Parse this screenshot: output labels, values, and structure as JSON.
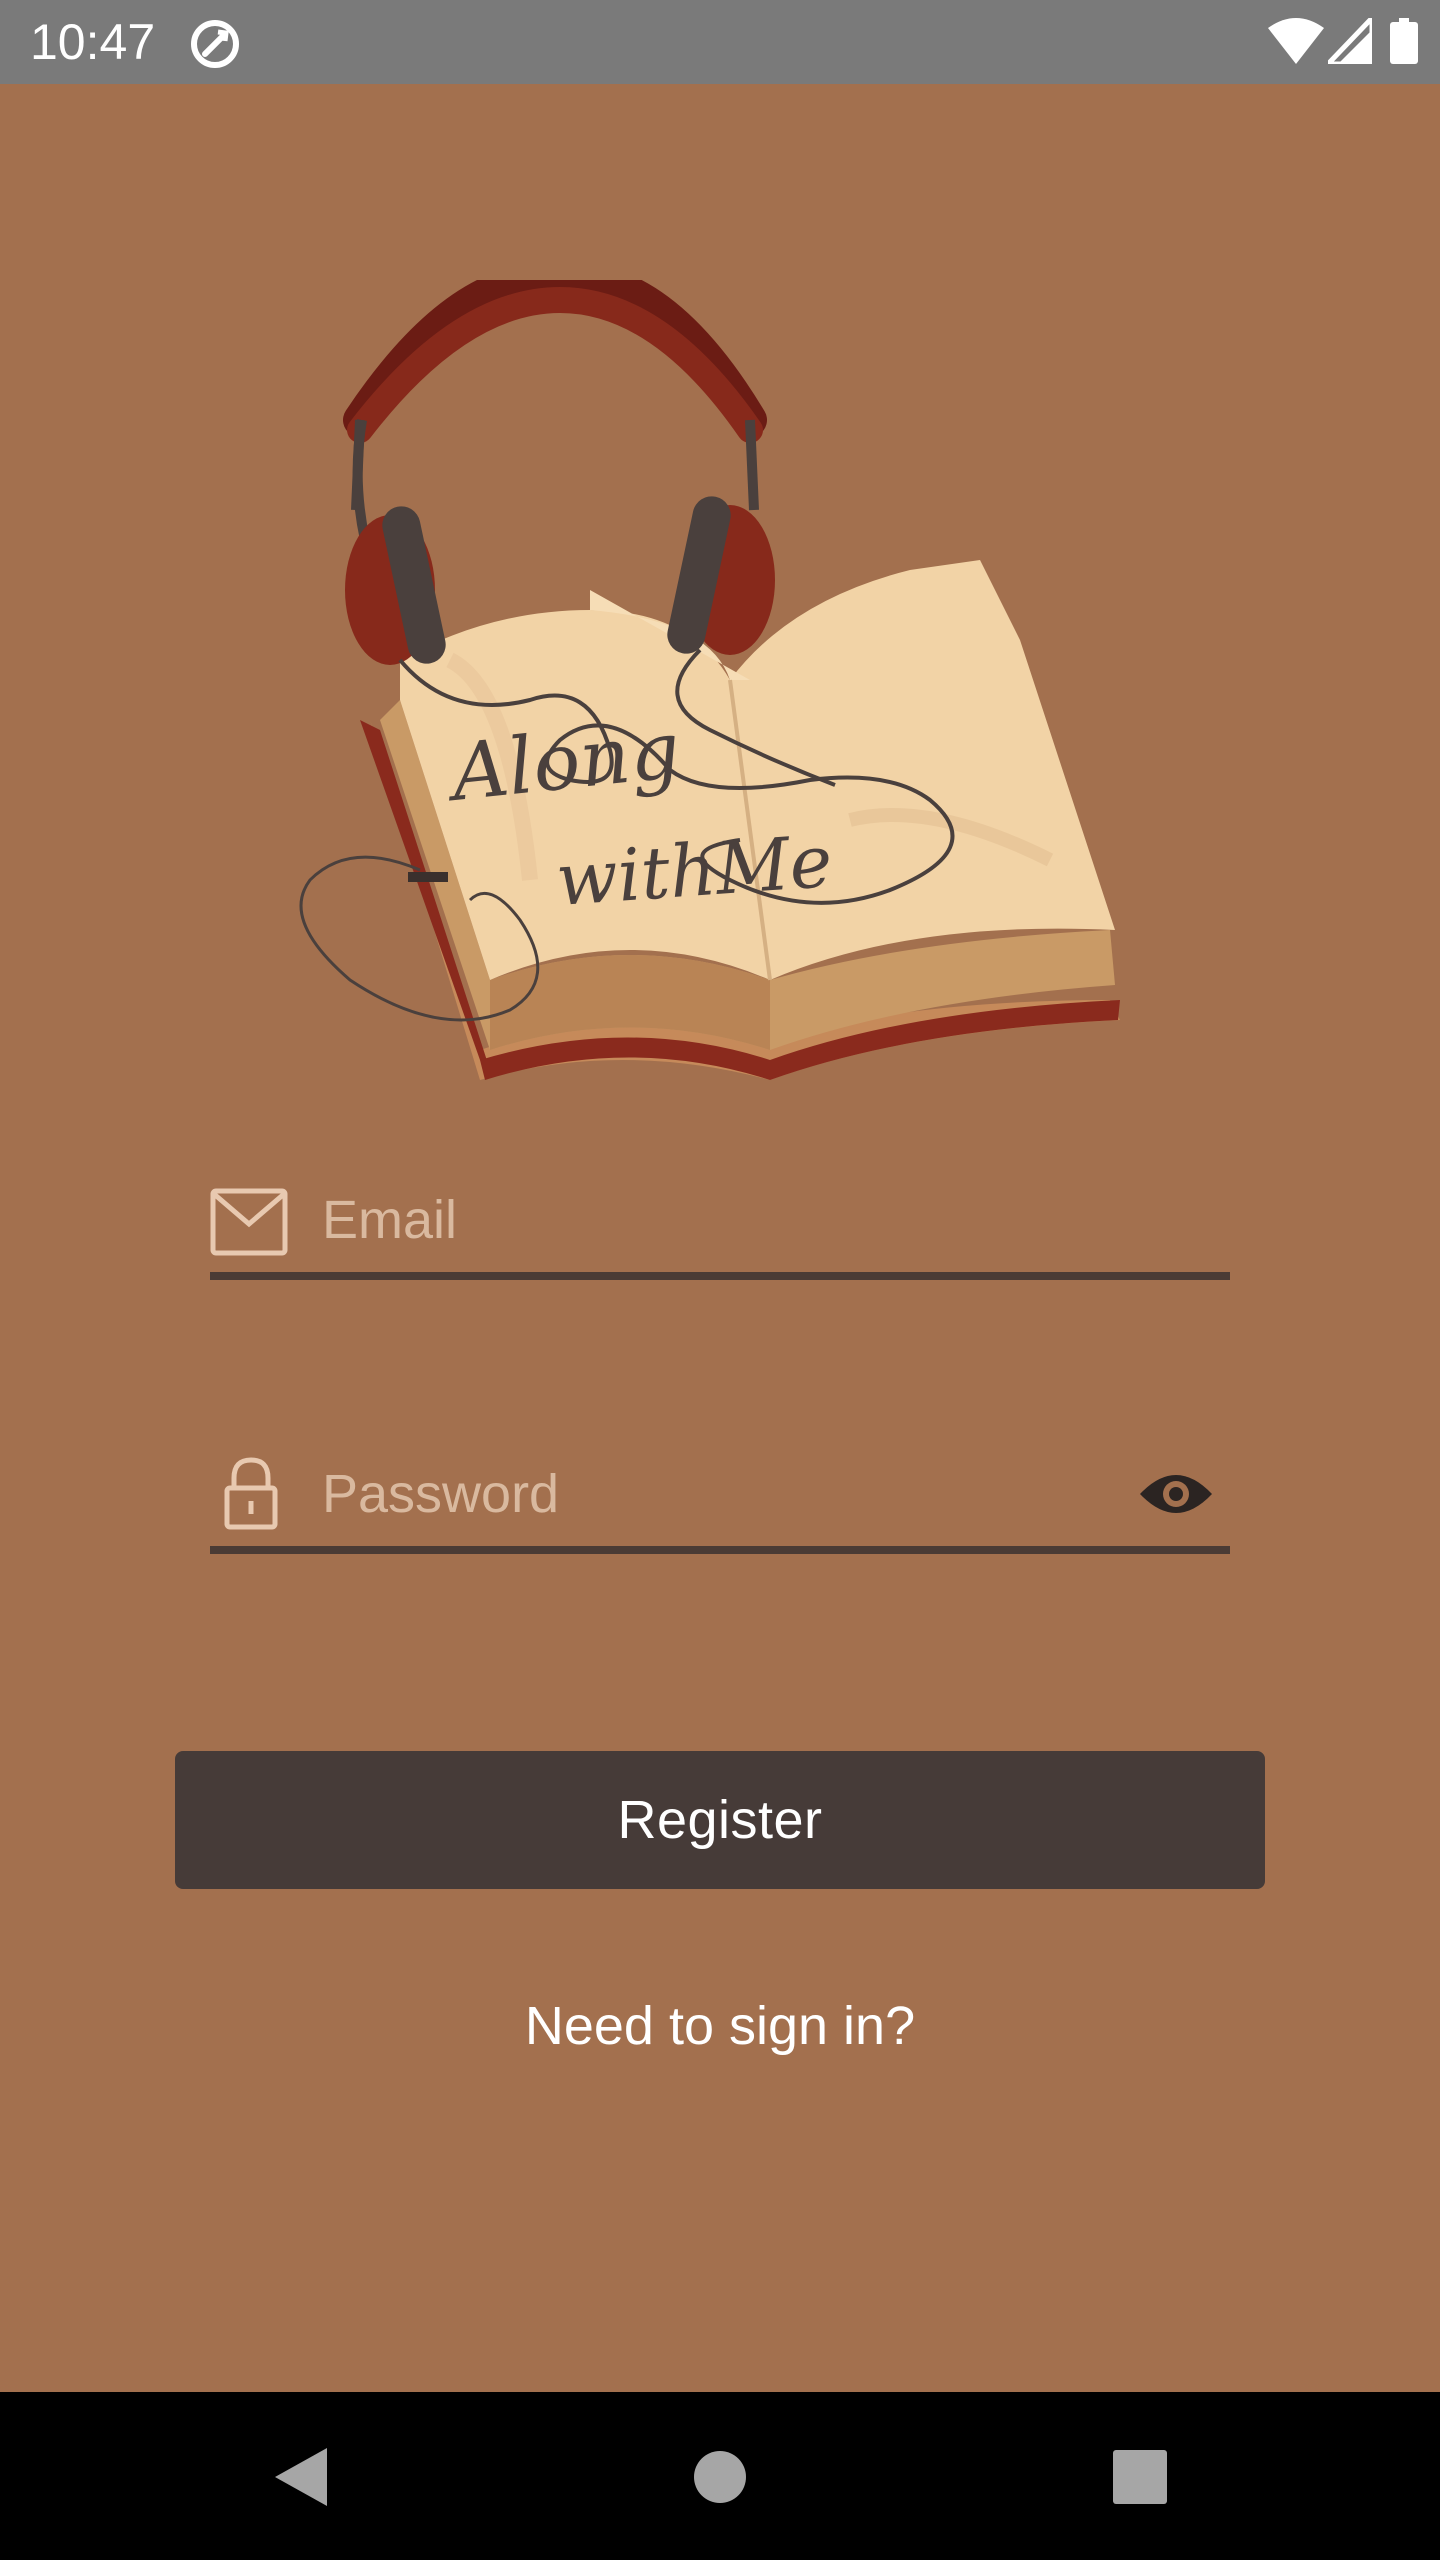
{
  "status_bar": {
    "time": "10:47",
    "icons": [
      "sync-icon",
      "wifi-icon",
      "signal-icon",
      "battery-icon"
    ]
  },
  "logo": {
    "line1": "Along",
    "line2": "withMe"
  },
  "form": {
    "email_placeholder": "Email",
    "email_value": "",
    "password_placeholder": "Password",
    "password_value": ""
  },
  "actions": {
    "register_label": "Register",
    "signin_link": "Need to sign in?"
  },
  "colors": {
    "background": "#a3704e",
    "button": "#463b38",
    "underline": "#4a3b35",
    "placeholder": "#d9b99f"
  },
  "nav_bar": {
    "icons": [
      "back-icon",
      "home-icon",
      "recents-icon"
    ]
  }
}
